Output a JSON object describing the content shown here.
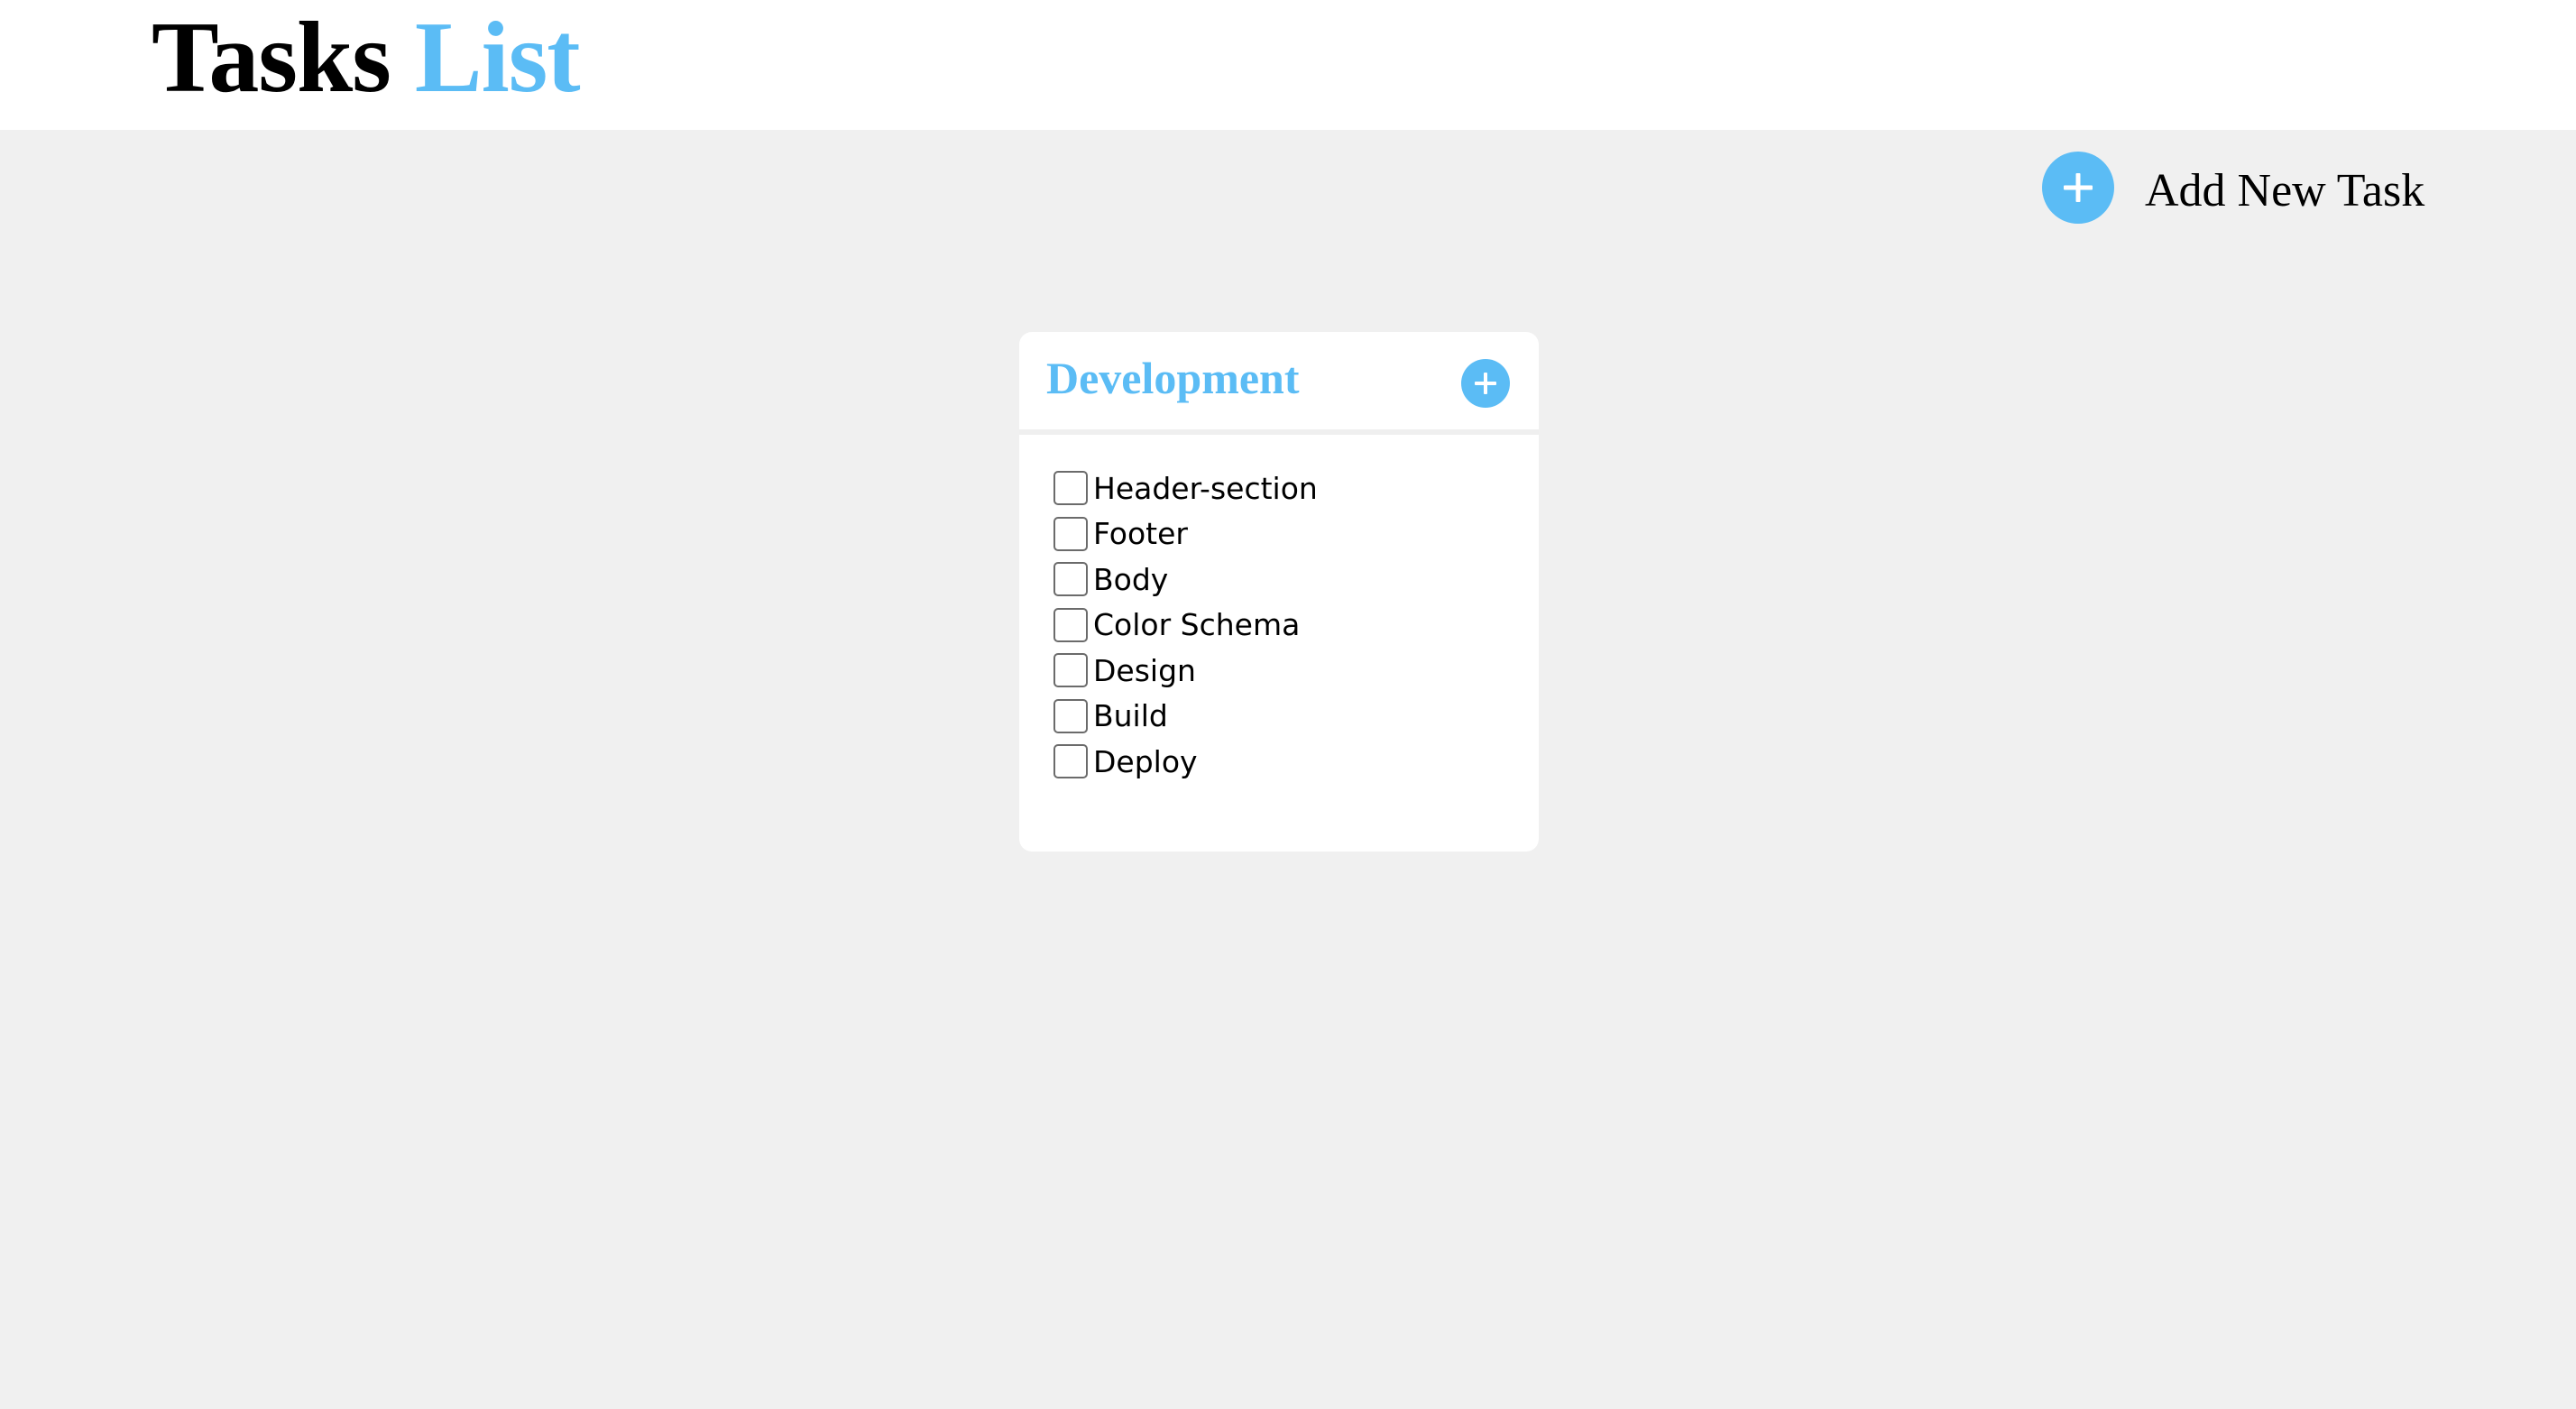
{
  "header": {
    "title_main": "Tasks",
    "title_accent": "List"
  },
  "toolbar": {
    "add_task_label": "Add New Task"
  },
  "card": {
    "title": "Development",
    "tasks": [
      {
        "label": "Header-section",
        "checked": false
      },
      {
        "label": "Footer",
        "checked": false
      },
      {
        "label": "Body",
        "checked": false
      },
      {
        "label": "Color Schema",
        "checked": false
      },
      {
        "label": "Design",
        "checked": false
      },
      {
        "label": "Build",
        "checked": false
      },
      {
        "label": "Deploy",
        "checked": false
      }
    ]
  },
  "icons": {
    "add_task": "plus-icon",
    "card_add": "plus-icon"
  },
  "colors": {
    "accent": "#5bbcf5",
    "background": "#f0f0f0",
    "card": "#ffffff"
  }
}
